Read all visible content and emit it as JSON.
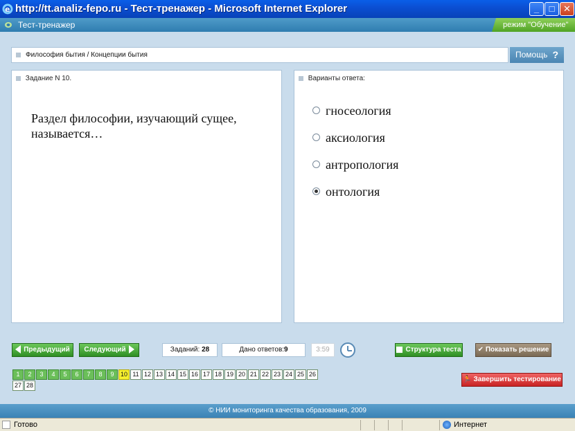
{
  "window": {
    "title": "http://tt.analiz-fepo.ru - Тест-тренажер - Microsoft Internet Explorer",
    "minimize": "_",
    "maximize": "□",
    "close": "✕"
  },
  "app": {
    "title": "Тест-тренажер",
    "mode": "режим \"Обучение\""
  },
  "breadcrumb": "Философия бытия / Концепции бытия",
  "help": {
    "label": "Помощь",
    "glyph": "?"
  },
  "task": {
    "header": "Задание N 10.",
    "question": "Раздел философии, изучающий сущее, называется…"
  },
  "answers": {
    "header": "Варианты ответа:",
    "options": [
      {
        "label": "гносеология",
        "selected": false
      },
      {
        "label": "аксиология",
        "selected": false
      },
      {
        "label": "антропология",
        "selected": false
      },
      {
        "label": "онтология",
        "selected": true
      }
    ]
  },
  "controls": {
    "prev": "Предыдущий",
    "next": "Следующий",
    "tasks_label": "Заданий:",
    "tasks_count": "28",
    "answered_label": "Дано ответов:",
    "answered_count": "9",
    "timer": "3:59",
    "structure": "Структура теста",
    "show_solution": "Показать решение",
    "finish": "Завершить тестирование"
  },
  "task_numbers": [
    "1",
    "2",
    "3",
    "4",
    "5",
    "6",
    "7",
    "8",
    "9",
    "10",
    "11",
    "12",
    "13",
    "14",
    "15",
    "16",
    "17",
    "18",
    "19",
    "20",
    "21",
    "22",
    "23",
    "24",
    "25",
    "26",
    "27",
    "28"
  ],
  "answered_upto": 9,
  "current_task": "10",
  "footer": "© НИИ мониторинга качества образования, 2009",
  "statusbar": {
    "ready": "Готово",
    "zone": "Интернет"
  },
  "colors": {
    "accent": "#3a82b5",
    "done": "#6bbf5a",
    "current": "#f6f02e",
    "finish": "#c82323"
  }
}
